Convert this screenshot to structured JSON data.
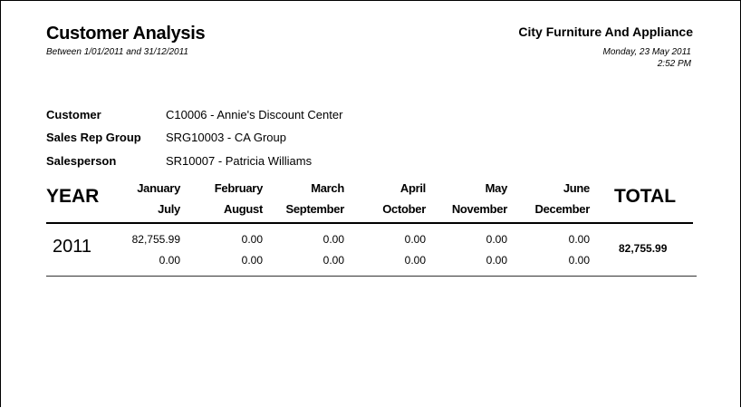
{
  "header": {
    "title": "Customer Analysis",
    "range": "Between 1/01/2011 and 31/12/2011",
    "company": "City Furniture And Appliance",
    "date": "Monday, 23 May 2011",
    "time": "2:52 PM"
  },
  "info": {
    "customer_label": "Customer",
    "customer_value": "C10006 - Annie's Discount Center",
    "sales_rep_group_label": "Sales Rep Group",
    "sales_rep_group_value": "SRG10003 - CA Group",
    "salesperson_label": "Salesperson",
    "salesperson_value": "SR10007 - Patricia Williams"
  },
  "table": {
    "year_header": "YEAR",
    "total_header": "TOTAL",
    "months_top": [
      "January",
      "February",
      "March",
      "April",
      "May",
      "June"
    ],
    "months_bottom": [
      "July",
      "August",
      "September",
      "October",
      "November",
      "December"
    ],
    "rows": [
      {
        "year": "2011",
        "top": [
          "82,755.99",
          "0.00",
          "0.00",
          "0.00",
          "0.00",
          "0.00"
        ],
        "bottom": [
          "0.00",
          "0.00",
          "0.00",
          "0.00",
          "0.00",
          "0.00"
        ],
        "total": "82,755.99"
      }
    ]
  }
}
